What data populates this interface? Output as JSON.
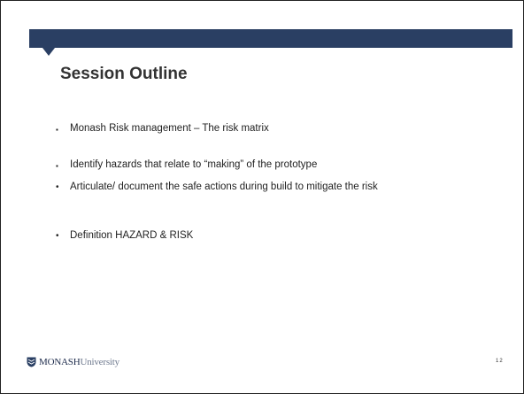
{
  "slide": {
    "title": "Session Outline",
    "bullets": [
      {
        "marker": "▪",
        "text": "Monash Risk management – The risk matrix"
      },
      {
        "marker": "▪",
        "text": "Identify hazards that relate to “making” of the prototype"
      },
      {
        "marker": "•",
        "text": "Articulate/ document the safe actions during build  to mitigate the risk"
      },
      {
        "marker": "•",
        "text": "Definition HAZARD & RISK"
      }
    ],
    "page_number": "12"
  },
  "footer": {
    "logo_bold": "MONASH",
    "logo_light": "University"
  },
  "colors": {
    "header_bar": "#2a3f63",
    "title": "#333333"
  }
}
